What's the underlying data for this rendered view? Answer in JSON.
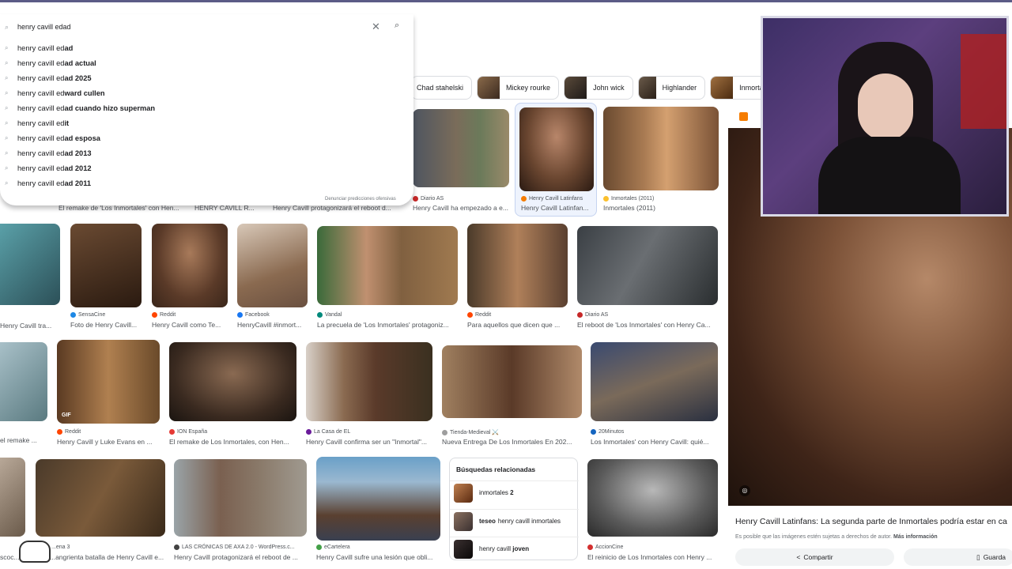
{
  "search": {
    "query": "henry cavill edad",
    "placeholder": "",
    "clear_label": "✕",
    "suggestions": [
      {
        "prefix": "henry cavill ed",
        "bold": "ad"
      },
      {
        "prefix": "henry cavill ed",
        "bold": "ad actual"
      },
      {
        "prefix": "henry cavill ed",
        "bold": "ad 2025"
      },
      {
        "prefix": "henry cavill ed",
        "bold": "ward cullen"
      },
      {
        "prefix": "henry cavill ed",
        "bold": "ad cuando hizo superman"
      },
      {
        "prefix": "henry cavill ed",
        "bold": "it"
      },
      {
        "prefix": "henry cavill ed",
        "bold": "ad esposa"
      },
      {
        "prefix": "henry cavill ed",
        "bold": "ad 2013"
      },
      {
        "prefix": "henry cavill ed",
        "bold": "ad 2012"
      },
      {
        "prefix": "henry cavill ed",
        "bold": "ad 2011"
      }
    ],
    "report_label": "Denunciar predicciones ofensivas"
  },
  "chips": [
    "Chad stahelski",
    "Mickey rourke",
    "John wick",
    "Highlander",
    "Inmortals"
  ],
  "row1_captions": [
    {
      "source": "",
      "caption": "El remake de 'Los Inmortales' con Hen..."
    },
    {
      "source": "",
      "caption": "HENRY CAVILL R..."
    },
    {
      "source": "",
      "caption": "Henry Cavill protagonizará el reboot d..."
    },
    {
      "source": "Diario AS",
      "caption": "Henry Cavill ha empezado a e..."
    },
    {
      "source": "Henry Cavill Latinfans",
      "caption": "Henry Cavill Latinfan..."
    },
    {
      "source": "Inmortales (2011)",
      "caption": "Inmortales (2011)"
    }
  ],
  "row2": [
    {
      "source": "",
      "caption": "Henry Cavill tra..."
    },
    {
      "source": "SensaCine",
      "caption": "Foto de Henry Cavill..."
    },
    {
      "source": "Reddit",
      "caption": "Henry Cavill como Te..."
    },
    {
      "source": "Facebook",
      "caption": "HenryCavill #inmort..."
    },
    {
      "source": "Vandal",
      "caption": "La precuela de 'Los Inmortales' protagoniz..."
    },
    {
      "source": "Reddit",
      "caption": "Para aquellos que dicen que ..."
    },
    {
      "source": "Diario AS",
      "caption": "El reboot de 'Los Inmortales' con Henry Ca..."
    }
  ],
  "row3": [
    {
      "source": "",
      "caption": "el remake ..."
    },
    {
      "source": "Reddit",
      "caption": "Henry Cavill y Luke Evans en ..."
    },
    {
      "source": "ION España",
      "caption": "El remake de Los Inmortales, con Hen..."
    },
    {
      "source": "La Casa de EL",
      "caption": "Henry Cavill confirma ser un \"Inmortal\"..."
    },
    {
      "source": "Tienda-Medieval ⚔️",
      "caption": "Nueva Entrega De Los Inmortales En 202..."
    },
    {
      "source": "20Minutos",
      "caption": "Los Inmortales' con Henry Cavill: quié..."
    }
  ],
  "row4": [
    {
      "source": "",
      "caption": "scoc..."
    },
    {
      "source": "...ena 3",
      "caption": "...angrienta batalla de Henry Cavill e..."
    },
    {
      "source": "LAS CRÓNICAS DE AXA 2.0 - WordPress.c...",
      "caption": "Henry Cavill protagonizará el reboot de ..."
    },
    {
      "source": "eCartelera",
      "caption": "Henry Cavill sufre una lesión que obli..."
    },
    {
      "source": "AccionCine",
      "caption": "El reinicio de Los Inmortales con Henry ..."
    }
  ],
  "gif_badge": "GIF",
  "related": {
    "heading": "Búsquedas relacionadas",
    "items": [
      {
        "bold": "",
        "text": "inmortales",
        "bold_after": "2"
      },
      {
        "bold": "teseo",
        "text": "henry cavill inmortales",
        "bold_after": ""
      },
      {
        "bold": "",
        "text": "henry cavill",
        "bold_after": "joven"
      }
    ]
  },
  "preview": {
    "title": "Henry Cavill Latinfans: La segunda parte de Inmortales podría estar en ca",
    "copyright": "Es posible que las imágenes estén sujetas a derechos de autor.",
    "more_info": "Más información",
    "share_label": "Compartir",
    "save_label": "Guarda"
  },
  "colors": {
    "accent": "#1a73e8",
    "topline": "#5b5b86"
  }
}
